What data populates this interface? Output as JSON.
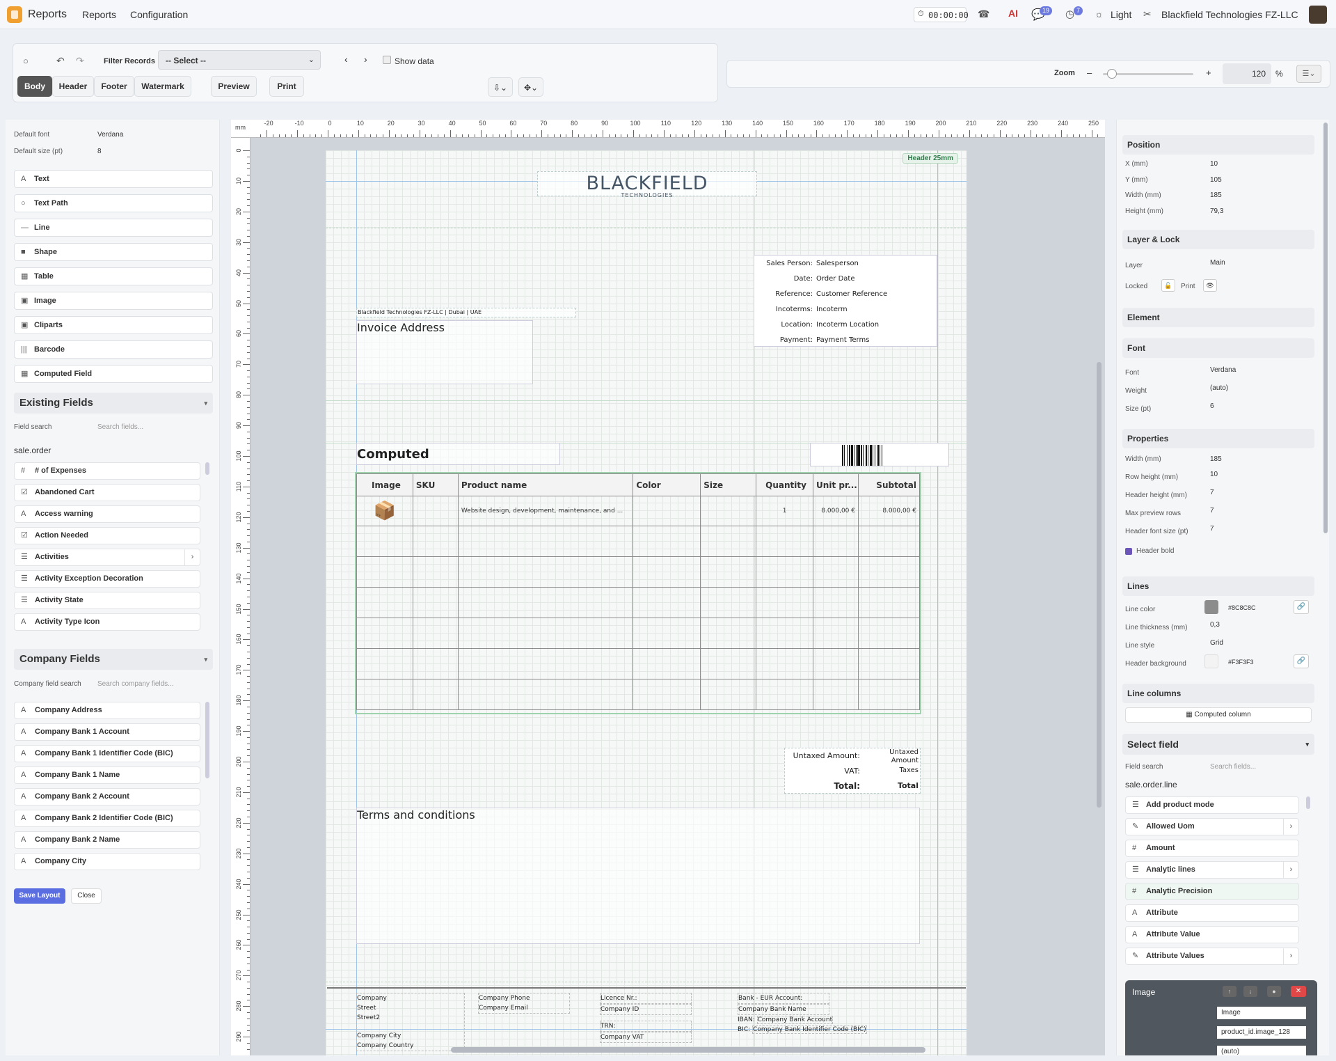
{
  "app": {
    "title": "Reports",
    "menu": [
      "Reports",
      "Configuration"
    ],
    "timer": "00:00:00",
    "messages_count": "19",
    "activities_count": "7",
    "theme_label": "Light",
    "company_name": "Blackfield Technologies FZ-LLC"
  },
  "toolbar": {
    "filter_label": "Filter Records",
    "filter_value": "-- Select --",
    "show_data_label": "Show data",
    "tabs": [
      "Body",
      "Header",
      "Footer",
      "Watermark"
    ],
    "preview_label": "Preview",
    "print_label": "Print",
    "zoom_label": "Zoom",
    "zoom_minus": "–",
    "zoom_plus": "+",
    "zoom_value": "120",
    "zoom_unit": "%",
    "zoom_level": 0.1
  },
  "left_panel": {
    "default_font_label": "Default font",
    "default_font_value": "Verdana",
    "default_size_label": "Default size (pt)",
    "default_size_value": "8",
    "tools": [
      {
        "icon": "A",
        "label": "Text"
      },
      {
        "icon": "○",
        "label": "Text Path"
      },
      {
        "icon": "—",
        "label": "Line"
      },
      {
        "icon": "■",
        "label": "Shape"
      },
      {
        "icon": "▦",
        "label": "Table"
      },
      {
        "icon": "▣",
        "label": "Image"
      },
      {
        "icon": "▣",
        "label": "Cliparts"
      },
      {
        "icon": "|||",
        "label": "Barcode"
      },
      {
        "icon": "▦",
        "label": "Computed Field"
      }
    ],
    "existing_fields_title": "Existing Fields",
    "field_search_label": "Field search",
    "field_search_placeholder": "Search fields...",
    "model_name": "sale.order",
    "fields": [
      {
        "icon": "#",
        "label": "# of Expenses"
      },
      {
        "icon": "☑",
        "label": "Abandoned Cart"
      },
      {
        "icon": "A",
        "label": "Access warning"
      },
      {
        "icon": "☑",
        "label": "Action Needed"
      },
      {
        "icon": "☰",
        "label": "Activities",
        "chevron": "›"
      },
      {
        "icon": "☰",
        "label": "Activity Exception Decoration"
      },
      {
        "icon": "☰",
        "label": "Activity State"
      },
      {
        "icon": "A",
        "label": "Activity Type Icon"
      }
    ],
    "company_fields_title": "Company Fields",
    "company_search_label": "Company field search",
    "company_search_placeholder": "Search company fields...",
    "company_fields": [
      "Company Address",
      "Company Bank 1 Account",
      "Company Bank 1 Identifier Code (BIC)",
      "Company Bank 1 Name",
      "Company Bank 2 Account",
      "Company Bank 2 Identifier Code (BIC)",
      "Company Bank 2 Name",
      "Company City"
    ],
    "save_label": "Save Layout",
    "close_label": "Close"
  },
  "ruler": {
    "unit": "mm",
    "h_ticks": [
      "-20",
      "-10",
      "0",
      "10",
      "20",
      "30",
      "40",
      "50",
      "60",
      "70",
      "80",
      "90",
      "100",
      "110",
      "120",
      "130",
      "140",
      "150",
      "160",
      "170",
      "180",
      "190",
      "200",
      "210",
      "220",
      "230",
      "240",
      "250"
    ],
    "v_ticks": [
      "0",
      "10",
      "20",
      "30",
      "40",
      "50",
      "60",
      "70",
      "80",
      "90",
      "100",
      "110",
      "120",
      "130",
      "140",
      "150",
      "160",
      "170",
      "180",
      "190",
      "200",
      "210",
      "220",
      "230",
      "240",
      "250",
      "260",
      "270",
      "280",
      "290"
    ]
  },
  "document": {
    "header_badge": "Header 25mm",
    "logo_name": "BLACKFIELD",
    "logo_sub": "TECHNOLOGIES",
    "info": [
      {
        "label": "Sales Person:",
        "value": "Salesperson"
      },
      {
        "label": "Date:",
        "value": "Order Date"
      },
      {
        "label": "Reference:",
        "value": "Customer Reference"
      },
      {
        "label": "Incoterms:",
        "value": "Incoterm"
      },
      {
        "label": "Location:",
        "value": "Incoterm Location"
      },
      {
        "label": "Payment:",
        "value": "Payment Terms"
      }
    ],
    "sender_line": "Blackfield Technologies FZ-LLC | Dubai | UAE",
    "invoice_address": "Invoice Address",
    "computed_title": "Computed",
    "table_headers": [
      "Image",
      "SKU",
      "Product name",
      "Color",
      "Size",
      "Quantity",
      "Unit pr...",
      "Subtotal"
    ],
    "row": {
      "product": "Website design, development, maintenance, and ...",
      "quantity": "1",
      "unit_price": "8.000,00 €",
      "subtotal": "8.000,00 €"
    },
    "totals": [
      {
        "label": "Untaxed Amount:",
        "value": "Untaxed Amount"
      },
      {
        "label": "VAT:",
        "value": "Taxes"
      },
      {
        "label": "Total:",
        "value": "Total"
      }
    ],
    "terms": "Terms and conditions",
    "footer": {
      "col1": [
        "Company",
        "Street",
        "Street2",
        "Company City",
        "Company Country"
      ],
      "col2": [
        "Company Phone",
        "Company Email"
      ],
      "col3": [
        "Licence Nr.:",
        "Company ID",
        "TRN:",
        "Company VAT"
      ],
      "col4": [
        "Bank - EUR Account:",
        "Company Bank Name",
        "IBAN:",
        "Company Bank Account",
        "BIC:",
        "Company Bank Identifier Code (BIC)"
      ]
    }
  },
  "right_panel": {
    "position_title": "Position",
    "position": [
      {
        "label": "X (mm)",
        "value": "10"
      },
      {
        "label": "Y (mm)",
        "value": "105"
      },
      {
        "label": "Width (mm)",
        "value": "185"
      },
      {
        "label": "Height (mm)",
        "value": "79,3"
      }
    ],
    "layer_title": "Layer & Lock",
    "layer_label": "Layer",
    "layer_value": "Main",
    "locked_label": "Locked",
    "print_label": "Print",
    "element_title": "Element",
    "font_title": "Font",
    "font": [
      {
        "label": "Font",
        "value": "Verdana"
      },
      {
        "label": "Weight",
        "value": "(auto)"
      },
      {
        "label": "Size (pt)",
        "value": "6"
      }
    ],
    "properties_title": "Properties",
    "properties": [
      {
        "label": "Width (mm)",
        "value": "185"
      },
      {
        "label": "Row height (mm)",
        "value": "10"
      },
      {
        "label": "Header height (mm)",
        "value": "7"
      },
      {
        "label": "Max preview rows",
        "value": "7"
      },
      {
        "label": "Header font size (pt)",
        "value": "7"
      }
    ],
    "header_bold_label": "Header bold",
    "lines_title": "Lines",
    "line_color_label": "Line color",
    "line_color": "#8C8C8C",
    "line_thickness_label": "Line thickness (mm)",
    "line_thickness": "0,3",
    "line_style_label": "Line style",
    "line_style": "Grid",
    "header_bg_label": "Header background",
    "header_bg": "#F3F3F3",
    "line_columns_title": "Line columns",
    "computed_column_label": "Computed column",
    "select_field_title": "Select field",
    "field_search_label": "Field search",
    "field_search_placeholder": "Search fields...",
    "model_name": "sale.order.line",
    "fields": [
      {
        "icon": "☰",
        "label": "Add product mode"
      },
      {
        "icon": "✎",
        "label": "Allowed Uom",
        "chevron": "›"
      },
      {
        "icon": "#",
        "label": "Amount"
      },
      {
        "icon": "☰",
        "label": "Analytic lines",
        "chevron": "›"
      },
      {
        "icon": "#",
        "label": "Analytic Precision"
      },
      {
        "icon": "A",
        "label": "Attribute"
      },
      {
        "icon": "A",
        "label": "Attribute Value"
      },
      {
        "icon": "✎",
        "label": "Attribute Values",
        "chevron": "›"
      }
    ],
    "image_title": "Image",
    "image_fields": [
      "Image",
      "product_id.image_128",
      "(auto)"
    ]
  }
}
